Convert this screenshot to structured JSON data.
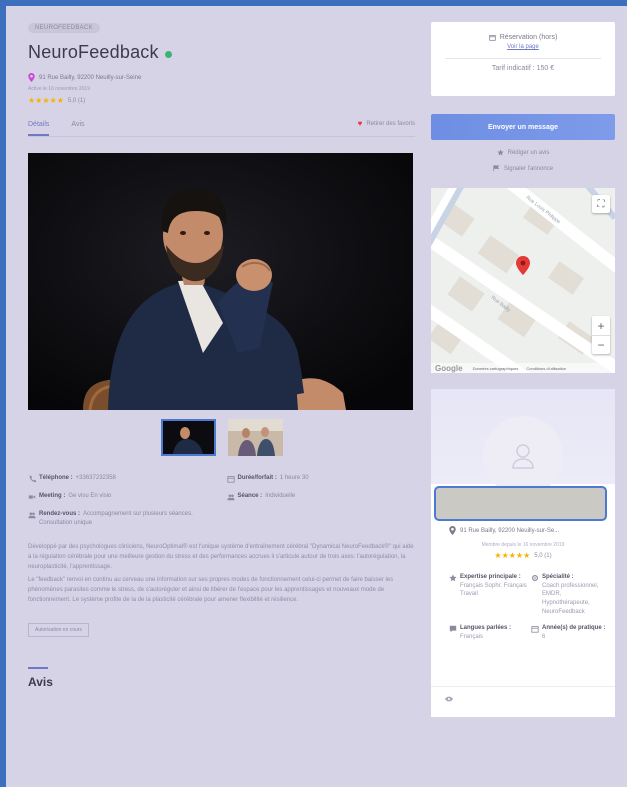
{
  "listing": {
    "category": "NEUROFEEDBACK",
    "title": "NeuroFeedback",
    "address": "91 Rue Bailly, 92200 Neuilly-sur-Seine",
    "member_since": "Active le 16 novembre 2019",
    "stars": "★★★★★",
    "rating": "5,0 (1)"
  },
  "tabs": [
    {
      "label": "Détails"
    },
    {
      "label": "Avis"
    }
  ],
  "favorite_label": "Retirer des favoris",
  "info": {
    "phone_label": "Téléphone :",
    "phone_value": "+33637232358",
    "duration_label": "Durée/forfait :",
    "duration_value": "1 heure 30",
    "meeting_label": "Meeting :",
    "meeting_value": "Ge visu En visio",
    "seance_label": "Séance :",
    "seance_value": "Individuelle",
    "rdv_label": "Rendez-vous :",
    "rdv_value": "Accompagnement sur plusieurs séances. Consultation unique"
  },
  "description": [
    "Développé par des psychologues cliniciens, NeuroOptimal® est l'unique système d'entraînement cérébral \"Dynamical NeuroFeedback®\" qui aide à la régulation cérébrale pour une meilleure gestion du stress et des performances accrues il s'articule autour de trois axes: l'autorégulation, la neuroplasticité, l'apprentissage.",
    "Le \"feedback\" renvoi en continu au cerveau une information sur ses propres modes de fonctionnement celui-ci permet de faire baisser les phénomènes parasites comme le stress, de s'autoréguler et ainsi de libérer de l'espace pour les apprentissages et nouveaux mode de fonctionnement. Le système profite de la de la plasticité cérébrale pour amener flexibilité et résilience."
  ],
  "tag": "Autorisation en cours",
  "reviews_title": "Avis",
  "sidebar": {
    "reservation_title": "Réservation (hors)",
    "reservation_link": "Voir la page",
    "price": "Tarif indicatif : 150 €",
    "message_button": "Envoyer un message",
    "review_link": "Rédiger un avis",
    "report_link": "Signaler l'annonce"
  },
  "map": {
    "footer_data": "Données cartographiques",
    "footer_terms": "Conditions d'utilisation",
    "google": "Google"
  },
  "profile": {
    "address": "91 Rue Bailly, 92200 Neuilly-sur-Se...",
    "member_since": "Membre depuis le 16 novembre 2019",
    "stars": "★★★★★",
    "rating": "5,0 (1)",
    "expertise_label": "Expertise principale :",
    "expertise_value": "Français Sophr. Français Travail",
    "specialty_label": "Spécialité :",
    "specialty_value": "Coach professionnel, EMDR, Hypnothérapeute, NeuroFeedback",
    "languages_label": "Langues parlées :",
    "languages_value": "Français",
    "years_label": "Année(s) de pratique :",
    "years_value": "6"
  },
  "colors": {
    "accent": "#6f79c9",
    "button": "#7595e6",
    "heart": "#e53935",
    "stars": "#f5b301",
    "online": "#3cb371",
    "frame": "#3d6fbf"
  }
}
